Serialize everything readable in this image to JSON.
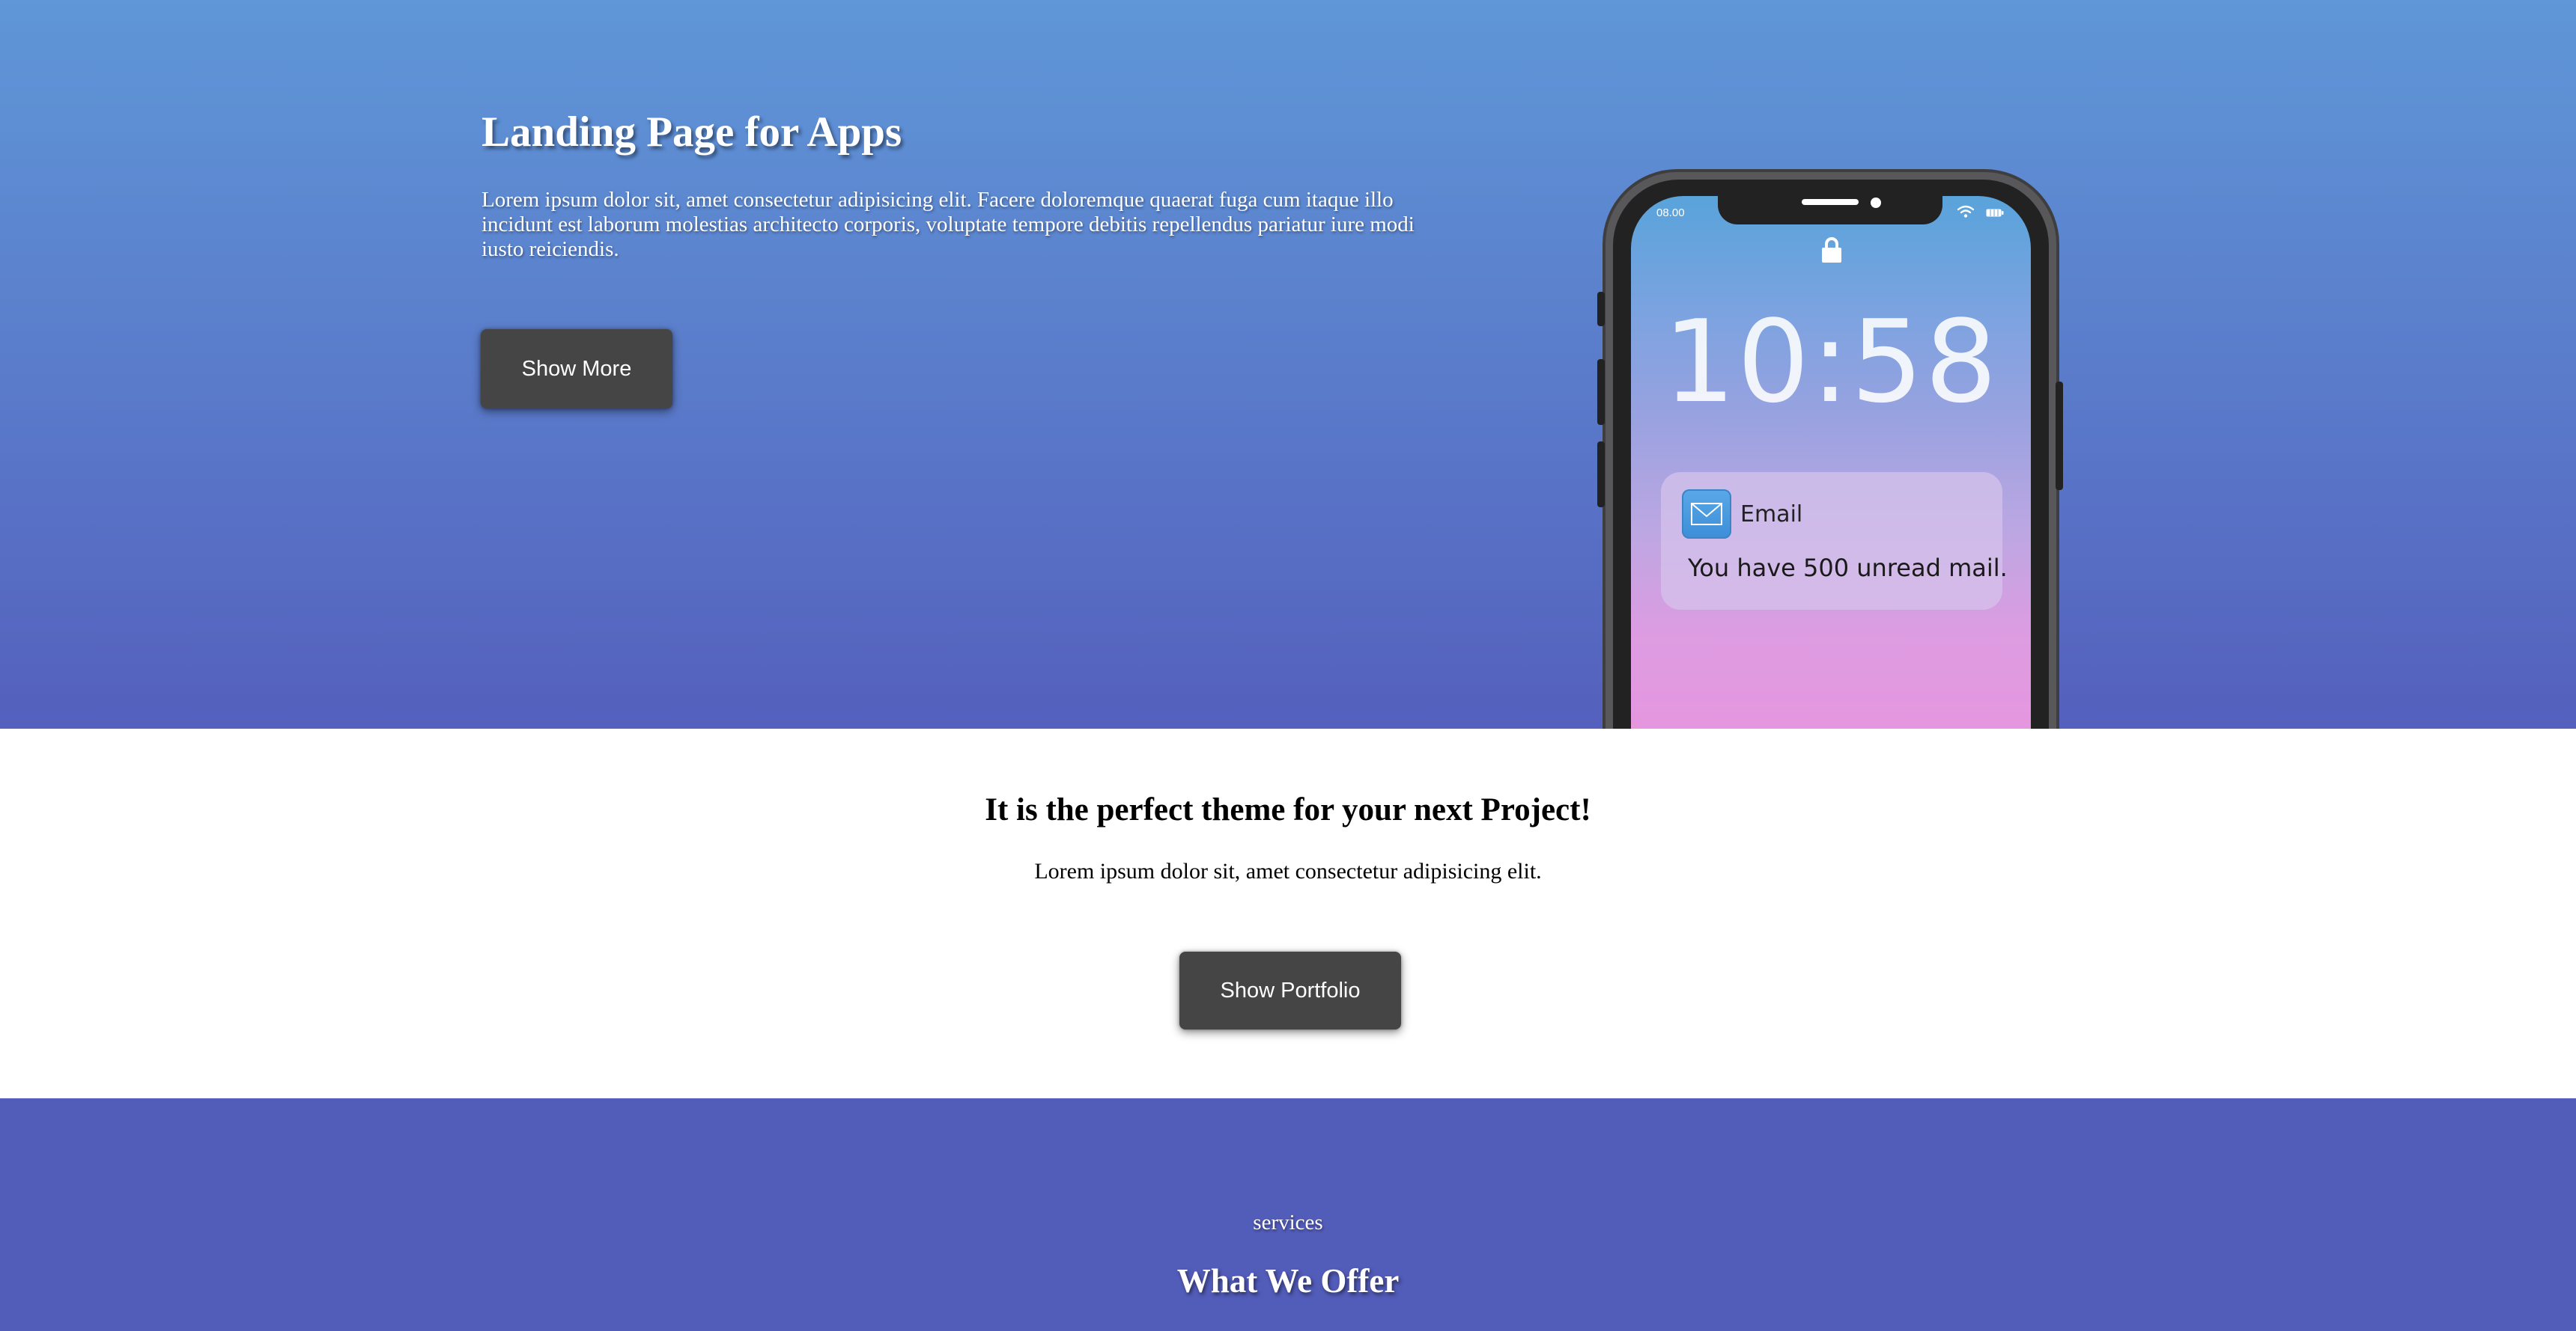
{
  "hero": {
    "title": "Landing Page for Apps",
    "text": "Lorem ipsum dolor sit, amet consectetur adipisicing elit. Facere doloremque quaerat fuga cum itaque illo incidunt est laborum molestias architecto corporis, voluptate tempore debitis repellendus pariatur iure modi iusto reiciendis.",
    "button_label": "Show More"
  },
  "phone": {
    "status_time": "08.00",
    "clock": "10:58",
    "notification": {
      "app": "Email",
      "message": "You have 500 unread mail."
    }
  },
  "middle": {
    "title": "It is the perfect theme for your next Project!",
    "text": "Lorem ipsum dolor sit, amet consectetur adipisicing elit.",
    "button_label": "Show Portfolio"
  },
  "services": {
    "label": "services",
    "title": "What We Offer"
  },
  "colors": {
    "hero_top": "#5f97d8",
    "hero_bottom": "#5460bd",
    "button_bg": "#454545",
    "services_bg": "#525cb9"
  }
}
